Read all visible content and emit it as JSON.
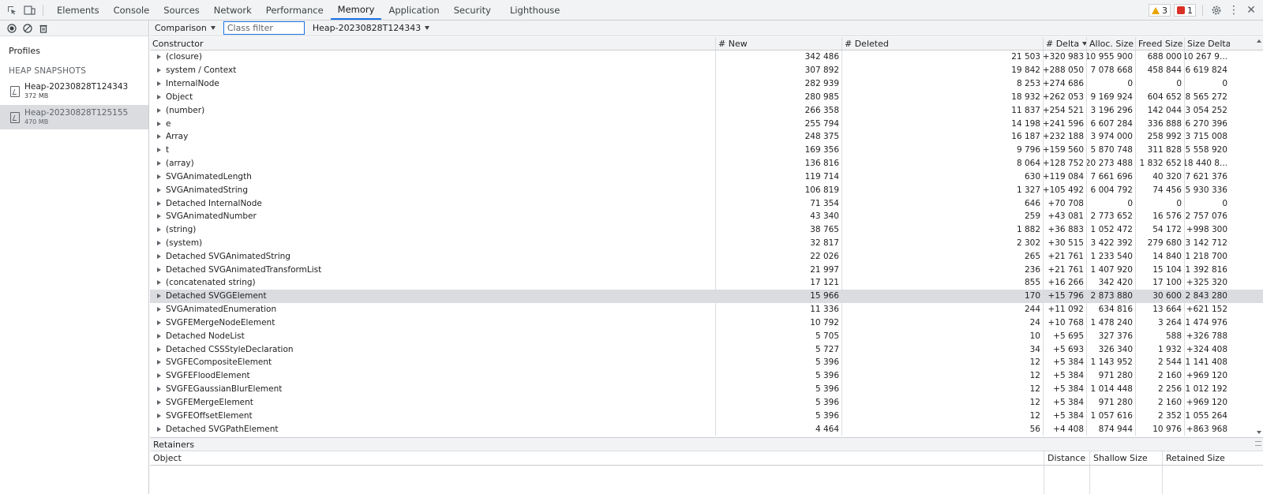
{
  "tabbar": {
    "tabs": [
      {
        "label": "Elements",
        "name": "tab-elements"
      },
      {
        "label": "Console",
        "name": "tab-console"
      },
      {
        "label": "Sources",
        "name": "tab-sources"
      },
      {
        "label": "Network",
        "name": "tab-network"
      },
      {
        "label": "Performance",
        "name": "tab-performance"
      },
      {
        "label": "Memory",
        "name": "tab-memory",
        "active": true
      },
      {
        "label": "Application",
        "name": "tab-application"
      },
      {
        "label": "Security",
        "name": "tab-security"
      },
      {
        "label": "Lighthouse",
        "name": "tab-lighthouse"
      }
    ],
    "warnings_count": "3",
    "errors_count": "1"
  },
  "sidebar": {
    "profiles_label": "Profiles",
    "heap_snapshots_heading": "HEAP SNAPSHOTS",
    "snapshots": [
      {
        "name": "Heap-20230828T124343",
        "size": "372 MB",
        "selected": false
      },
      {
        "name": "Heap-20230828T125155",
        "size": "470 MB",
        "selected": true
      }
    ]
  },
  "toolbar": {
    "view_select": "Comparison",
    "class_filter_placeholder": "Class filter",
    "base_snapshot_select": "Heap-20230828T124343"
  },
  "table": {
    "headers": {
      "constructor": "Constructor",
      "new": "# New",
      "deleted": "# Deleted",
      "delta": "# Delta",
      "alloc_size": "Alloc. Size",
      "freed_size": "Freed Size",
      "size_delta": "Size Delta"
    },
    "rows": [
      {
        "c": "(closure)",
        "n": "342 486",
        "d": "21 503",
        "dl": "+320 983",
        "a": "10 955 900",
        "f": "688 000",
        "s": "+10 267 9..."
      },
      {
        "c": "system / Context",
        "n": "307 892",
        "d": "19 842",
        "dl": "+288 050",
        "a": "7 078 668",
        "f": "458 844",
        "s": "+6 619 824"
      },
      {
        "c": "InternalNode",
        "n": "282 939",
        "d": "8 253",
        "dl": "+274 686",
        "a": "0",
        "f": "0",
        "s": "0"
      },
      {
        "c": "Object",
        "n": "280 985",
        "d": "18 932",
        "dl": "+262 053",
        "a": "9 169 924",
        "f": "604 652",
        "s": "+8 565 272"
      },
      {
        "c": "(number)",
        "n": "266 358",
        "d": "11 837",
        "dl": "+254 521",
        "a": "3 196 296",
        "f": "142 044",
        "s": "+3 054 252"
      },
      {
        "c": "e",
        "n": "255 794",
        "d": "14 198",
        "dl": "+241 596",
        "a": "6 607 284",
        "f": "336 888",
        "s": "+6 270 396"
      },
      {
        "c": "Array",
        "n": "248 375",
        "d": "16 187",
        "dl": "+232 188",
        "a": "3 974 000",
        "f": "258 992",
        "s": "+3 715 008"
      },
      {
        "c": "t",
        "n": "169 356",
        "d": "9 796",
        "dl": "+159 560",
        "a": "5 870 748",
        "f": "311 828",
        "s": "+5 558 920"
      },
      {
        "c": "(array)",
        "n": "136 816",
        "d": "8 064",
        "dl": "+128 752",
        "a": "20 273 488",
        "f": "1 832 652",
        "s": "+18 440 8..."
      },
      {
        "c": "SVGAnimatedLength",
        "n": "119 714",
        "d": "630",
        "dl": "+119 084",
        "a": "7 661 696",
        "f": "40 320",
        "s": "+7 621 376"
      },
      {
        "c": "SVGAnimatedString",
        "n": "106 819",
        "d": "1 327",
        "dl": "+105 492",
        "a": "6 004 792",
        "f": "74 456",
        "s": "+5 930 336"
      },
      {
        "c": "Detached InternalNode",
        "n": "71 354",
        "d": "646",
        "dl": "+70 708",
        "a": "0",
        "f": "0",
        "s": "0"
      },
      {
        "c": "SVGAnimatedNumber",
        "n": "43 340",
        "d": "259",
        "dl": "+43 081",
        "a": "2 773 652",
        "f": "16 576",
        "s": "+2 757 076"
      },
      {
        "c": "(string)",
        "n": "38 765",
        "d": "1 882",
        "dl": "+36 883",
        "a": "1 052 472",
        "f": "54 172",
        "s": "+998 300"
      },
      {
        "c": "(system)",
        "n": "32 817",
        "d": "2 302",
        "dl": "+30 515",
        "a": "3 422 392",
        "f": "279 680",
        "s": "+3 142 712"
      },
      {
        "c": "Detached SVGAnimatedString",
        "n": "22 026",
        "d": "265",
        "dl": "+21 761",
        "a": "1 233 540",
        "f": "14 840",
        "s": "+1 218 700"
      },
      {
        "c": "Detached SVGAnimatedTransformList",
        "n": "21 997",
        "d": "236",
        "dl": "+21 761",
        "a": "1 407 920",
        "f": "15 104",
        "s": "+1 392 816"
      },
      {
        "c": "(concatenated string)",
        "n": "17 121",
        "d": "855",
        "dl": "+16 266",
        "a": "342 420",
        "f": "17 100",
        "s": "+325 320"
      },
      {
        "c": "Detached SVGGElement",
        "n": "15 966",
        "d": "170",
        "dl": "+15 796",
        "a": "2 873 880",
        "f": "30 600",
        "s": "+2 843 280",
        "selected": true
      },
      {
        "c": "SVGAnimatedEnumeration",
        "n": "11 336",
        "d": "244",
        "dl": "+11 092",
        "a": "634 816",
        "f": "13 664",
        "s": "+621 152"
      },
      {
        "c": "SVGFEMergeNodeElement",
        "n": "10 792",
        "d": "24",
        "dl": "+10 768",
        "a": "1 478 240",
        "f": "3 264",
        "s": "+1 474 976"
      },
      {
        "c": "Detached NodeList",
        "n": "5 705",
        "d": "10",
        "dl": "+5 695",
        "a": "327 376",
        "f": "588",
        "s": "+326 788"
      },
      {
        "c": "Detached CSSStyleDeclaration",
        "n": "5 727",
        "d": "34",
        "dl": "+5 693",
        "a": "326 340",
        "f": "1 932",
        "s": "+324 408"
      },
      {
        "c": "SVGFECompositeElement",
        "n": "5 396",
        "d": "12",
        "dl": "+5 384",
        "a": "1 143 952",
        "f": "2 544",
        "s": "+1 141 408"
      },
      {
        "c": "SVGFEFloodElement",
        "n": "5 396",
        "d": "12",
        "dl": "+5 384",
        "a": "971 280",
        "f": "2 160",
        "s": "+969 120"
      },
      {
        "c": "SVGFEGaussianBlurElement",
        "n": "5 396",
        "d": "12",
        "dl": "+5 384",
        "a": "1 014 448",
        "f": "2 256",
        "s": "+1 012 192"
      },
      {
        "c": "SVGFEMergeElement",
        "n": "5 396",
        "d": "12",
        "dl": "+5 384",
        "a": "971 280",
        "f": "2 160",
        "s": "+969 120"
      },
      {
        "c": "SVGFEOffsetElement",
        "n": "5 396",
        "d": "12",
        "dl": "+5 384",
        "a": "1 057 616",
        "f": "2 352",
        "s": "+1 055 264"
      },
      {
        "c": "Detached SVGPathElement",
        "n": "4 464",
        "d": "56",
        "dl": "+4 408",
        "a": "874 944",
        "f": "10 976",
        "s": "+863 968"
      }
    ]
  },
  "retainers": {
    "title": "Retainers",
    "headers": {
      "object": "Object",
      "distance": "Distance",
      "shallow_size": "Shallow Size",
      "retained_size": "Retained Size"
    }
  }
}
